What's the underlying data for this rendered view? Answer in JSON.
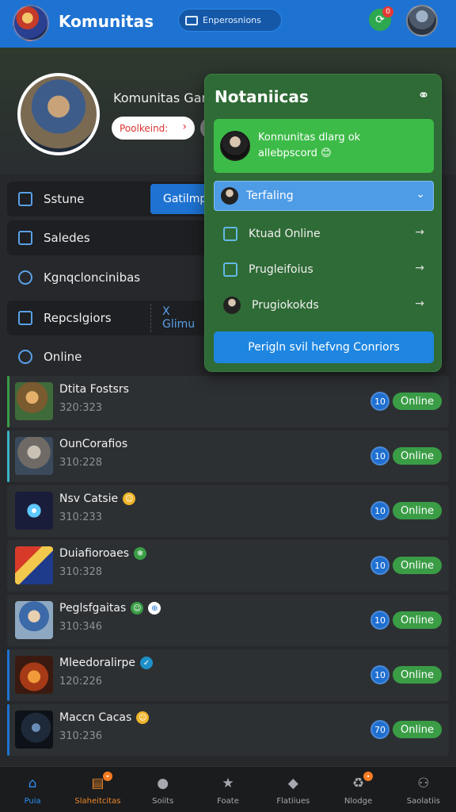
{
  "topbar": {
    "title": "Komunitas",
    "pill_label": "Enperosnions",
    "notif_count": "0",
    "logo_icon": "game-logo-icon",
    "pill_icon": "screen-icon",
    "colors": {
      "bar": "#1e73d2"
    }
  },
  "profile": {
    "name": "Komunitas Gam",
    "pill_label": "Poolkeind:",
    "pill_chevron": "›"
  },
  "menu": {
    "status": "Sstune",
    "tab_active": "Gatilmpo",
    "salades": "Saledes",
    "kgn": "Kgnqcloncinibas",
    "repcs": "Repcslgiors",
    "x_link": "X Glimu",
    "online": "Online"
  },
  "notifications": {
    "title": "Notaniicas",
    "close_icon": "⚭",
    "card_line1": "Konnunitas dlarg ok",
    "card_line2": "allebpscord 😊",
    "select_label": "Terfaling",
    "select_chevron": "⌄",
    "items": [
      {
        "label": "Ktuad Online",
        "arrow": "→"
      },
      {
        "label": "Prugleifoius",
        "arrow": "→"
      },
      {
        "label": "Prugiokokds",
        "arrow": "→"
      }
    ],
    "button_label": "Perigln svil hefvng Conriors"
  },
  "games": [
    {
      "name": "Dtita Fostsrs",
      "sub": "320:323",
      "count": "10",
      "status": "Online",
      "emoji": "",
      "emoji2": "",
      "accent": "#3a9d46"
    },
    {
      "name": "OunCorafios",
      "sub": "310:228",
      "count": "10",
      "status": "Online",
      "emoji": "",
      "emoji2": "",
      "accent": "#3bb3c9"
    },
    {
      "name": "Nsv Catsie",
      "sub": "310:233",
      "count": "10",
      "status": "Online",
      "emoji": "☺",
      "emoji2": "",
      "accent": ""
    },
    {
      "name": "Duiafioroaes",
      "sub": "310:328",
      "count": "10",
      "status": "Online",
      "emoji": "❄",
      "emoji2": "",
      "accent": ""
    },
    {
      "name": "Peglsfgaitas",
      "sub": "310:346",
      "count": "10",
      "status": "Online",
      "emoji": "☺",
      "emoji2": "⊕",
      "accent": ""
    },
    {
      "name": "Mleedoralirpe",
      "sub": "120:226",
      "count": "10",
      "status": "Online",
      "emoji": "✓",
      "emoji2": "",
      "accent": "#1e73d2"
    },
    {
      "name": "Maccn Cacas",
      "sub": "310:236",
      "count": "70",
      "status": "Online",
      "emoji": "☺",
      "emoji2": "",
      "accent": "#1e73d2"
    }
  ],
  "bottom_nav": [
    {
      "label": "Puia",
      "icon": "⌂"
    },
    {
      "label": "Slaheitcitas",
      "icon": "▤",
      "badge": "•"
    },
    {
      "label": "Soiits",
      "icon": "●"
    },
    {
      "label": "Foate",
      "icon": "★"
    },
    {
      "label": "Flatiiues",
      "icon": "◆"
    },
    {
      "label": "Nlodge",
      "icon": "♻",
      "badge": "•"
    },
    {
      "label": "Saolatiis",
      "icon": "⚇"
    }
  ]
}
